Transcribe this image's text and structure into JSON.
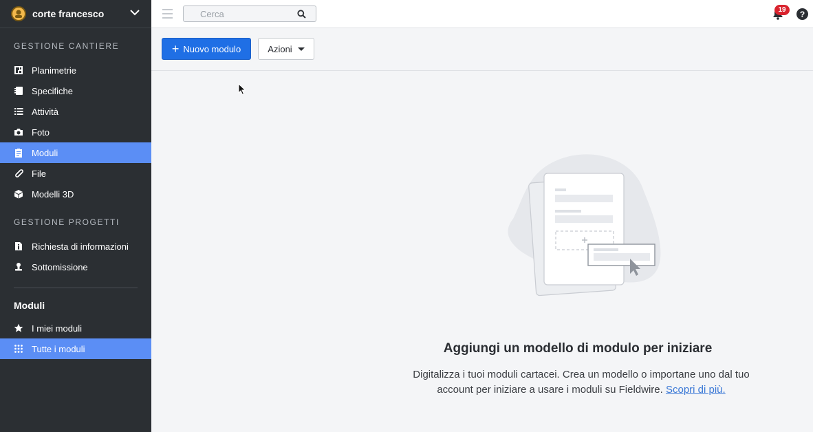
{
  "project": {
    "name": "corte francesco"
  },
  "search": {
    "placeholder": "Cerca"
  },
  "notifications": {
    "count": "19"
  },
  "help": {
    "label": "?"
  },
  "sidebar": {
    "section_cantiere": "GESTIONE CANTIERE",
    "cantiere_items": [
      {
        "label": "Planimetrie",
        "icon": "floorplan-icon"
      },
      {
        "label": "Specifiche",
        "icon": "notebook-icon"
      },
      {
        "label": "Attività",
        "icon": "list-icon"
      },
      {
        "label": "Foto",
        "icon": "camera-icon"
      },
      {
        "label": "Moduli",
        "icon": "clipboard-icon",
        "active": true
      },
      {
        "label": "File",
        "icon": "paperclip-icon"
      },
      {
        "label": "Modelli 3D",
        "icon": "cube-icon"
      }
    ],
    "section_progetti": "GESTIONE PROGETTI",
    "progetti_items": [
      {
        "label": "Richiesta di informazioni",
        "icon": "info-document-icon"
      },
      {
        "label": "Sottomissione",
        "icon": "stamp-icon"
      }
    ],
    "moduli_heading": "Moduli",
    "moduli_items": [
      {
        "label": "I miei moduli",
        "icon": "star-icon"
      },
      {
        "label": "Tutte i moduli",
        "icon": "grid-icon",
        "active": true
      }
    ]
  },
  "toolbar": {
    "new_button": "Nuovo modulo",
    "actions_button": "Azioni"
  },
  "empty_state": {
    "title": "Aggiungi un modello di modulo per iniziare",
    "description": "Digitalizza i tuoi moduli cartacei. Crea un modello o importane uno dal tuo account per iniziare a usare i moduli su Fieldwire.",
    "link": "Scopri di più."
  },
  "colors": {
    "sidebar_bg": "#2b2f33",
    "active_item": "#5b8ef5",
    "primary_button": "#1f6fe5",
    "badge": "#d9232e",
    "link": "#3a78d6"
  }
}
